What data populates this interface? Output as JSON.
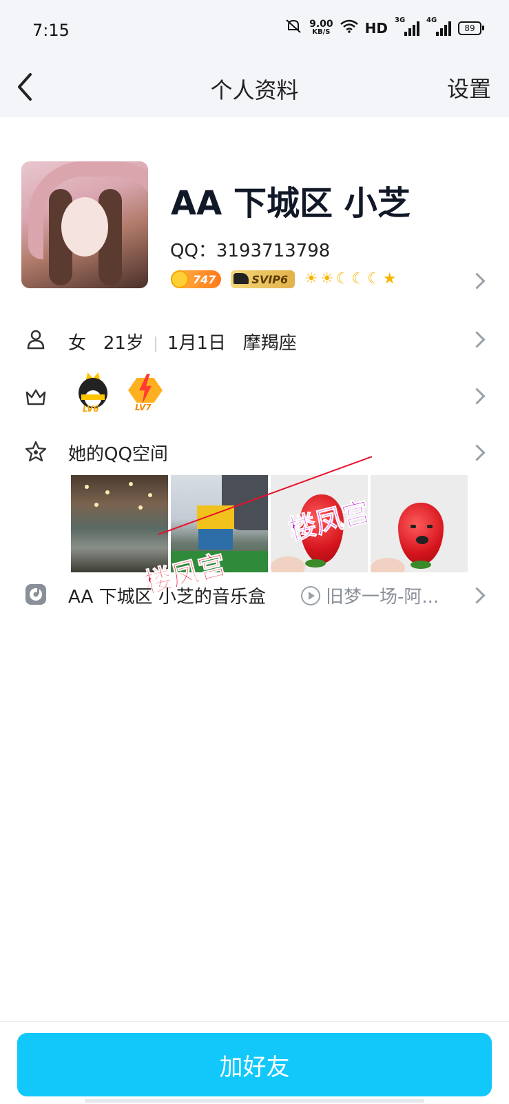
{
  "status_bar": {
    "time": "7:15",
    "net_speed": "9.00",
    "net_unit": "KB/S",
    "hd": "HD",
    "sim1": "3G",
    "sim2": "4G",
    "battery": "89"
  },
  "nav": {
    "title": "个人资料",
    "settings": "设置"
  },
  "profile": {
    "name": "AA 下城区 小芝",
    "qq": "QQ：3193713798",
    "coin_count": "747",
    "svip": "SVIP6"
  },
  "info": {
    "gender": "女",
    "age": "21岁",
    "birthday": "1月1日",
    "zodiac": "摩羯座"
  },
  "vip": {
    "qq_level": "LV6",
    "svip_level": "LV7"
  },
  "qzone": {
    "label": "她的QQ空间"
  },
  "watermark": {
    "text": "楼凤宫"
  },
  "music": {
    "label": "AA 下城区 小芝的音乐盒",
    "song": "旧梦一场-阿..."
  },
  "action": {
    "add_friend": "加好友"
  },
  "colors": {
    "primary": "#12c8fb",
    "nav_bg": "#f4f5f9",
    "level_icon": "#f7b500"
  }
}
